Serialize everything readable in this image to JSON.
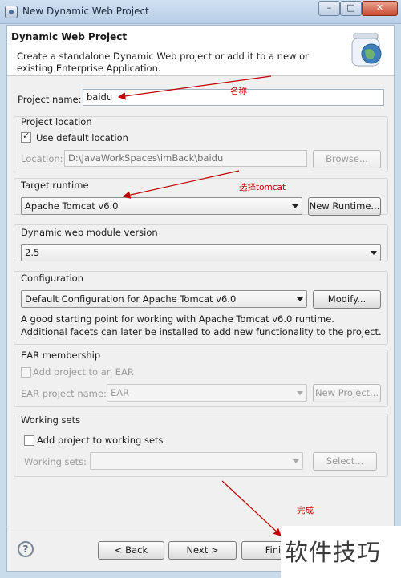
{
  "window": {
    "title": "New Dynamic Web Project",
    "minimize": "–",
    "maximize": "□",
    "close": "✕"
  },
  "header": {
    "title": "Dynamic Web Project",
    "description": "Create a standalone Dynamic Web project or add it to a new or existing Enterprise Application."
  },
  "project_name": {
    "label": "Project name:",
    "value": "baidu"
  },
  "location": {
    "group_label": "Project location",
    "use_default_label": "Use default location",
    "use_default_checked": true,
    "field_label": "Location:",
    "value": "D:\\JavaWorkSpaces\\imBack\\baidu",
    "browse": "Browse..."
  },
  "target_runtime": {
    "label": "Target runtime",
    "value": "Apache Tomcat v6.0",
    "new_button": "New Runtime..."
  },
  "module_version": {
    "label": "Dynamic web module version",
    "value": "2.5"
  },
  "configuration": {
    "label": "Configuration",
    "value": "Default Configuration for Apache Tomcat v6.0",
    "modify": "Modify...",
    "description": "A good starting point for working with Apache Tomcat v6.0 runtime. Additional facets can later be installed to add new functionality to the project."
  },
  "ear": {
    "label": "EAR membership",
    "add_label": "Add project to an EAR",
    "field_label": "EAR project name:",
    "value": "EAR",
    "new_button": "New Project..."
  },
  "working_sets": {
    "label": "Working sets",
    "add_label": "Add project to working sets",
    "field_label": "Working sets:",
    "value": "",
    "select_button": "Select..."
  },
  "footer": {
    "help": "?",
    "back": "< Back",
    "next": "Next >",
    "finish": "Finis"
  },
  "annotations": {
    "name": "名称",
    "tomcat": "选择tomcat",
    "finish": "完成"
  },
  "watermark": "软件技巧",
  "colors": {
    "annotation": "#c20000",
    "title_bar": "#cfe0f1"
  }
}
